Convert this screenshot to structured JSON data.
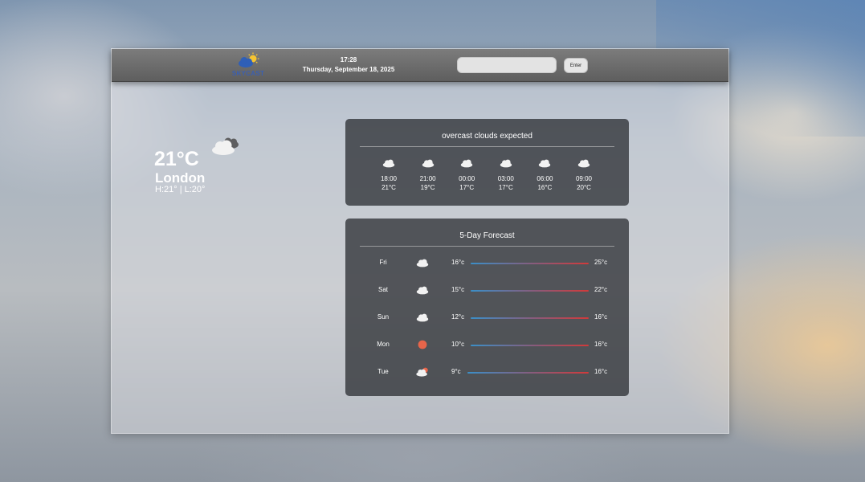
{
  "header": {
    "logo_text": "SKYCAST",
    "time": "17:28",
    "date": "Thursday, September 18, 2025",
    "search_placeholder": "",
    "enter_label": "Enter"
  },
  "current": {
    "temperature": "21°C",
    "city": "London",
    "high_low": "H:21° | L:20°",
    "icon": "broken-clouds-icon"
  },
  "hourly": {
    "title": "overcast clouds expected",
    "items": [
      {
        "time": "18:00",
        "temp": "21°C",
        "icon": "cloud-icon"
      },
      {
        "time": "21:00",
        "temp": "19°C",
        "icon": "cloud-icon"
      },
      {
        "time": "00:00",
        "temp": "17°C",
        "icon": "cloud-icon"
      },
      {
        "time": "03:00",
        "temp": "17°C",
        "icon": "cloud-icon"
      },
      {
        "time": "06:00",
        "temp": "16°C",
        "icon": "cloud-icon"
      },
      {
        "time": "09:00",
        "temp": "20°C",
        "icon": "cloud-icon"
      }
    ]
  },
  "daily": {
    "title": "5-Day Forecast",
    "items": [
      {
        "day": "Fri",
        "low": "16°c",
        "high": "25°c",
        "icon": "cloud-icon"
      },
      {
        "day": "Sat",
        "low": "15°c",
        "high": "22°c",
        "icon": "cloud-icon"
      },
      {
        "day": "Sun",
        "low": "12°c",
        "high": "16°c",
        "icon": "cloud-icon"
      },
      {
        "day": "Mon",
        "low": "10°c",
        "high": "16°c",
        "icon": "sun-icon"
      },
      {
        "day": "Tue",
        "low": "9°c",
        "high": "16°c",
        "icon": "sun-cloud-icon"
      }
    ]
  },
  "colors": {
    "logo": "#3b5fb0",
    "range_cold": "#3b8fc8",
    "range_hot": "#d23a3a",
    "sun": "#e8654a"
  }
}
